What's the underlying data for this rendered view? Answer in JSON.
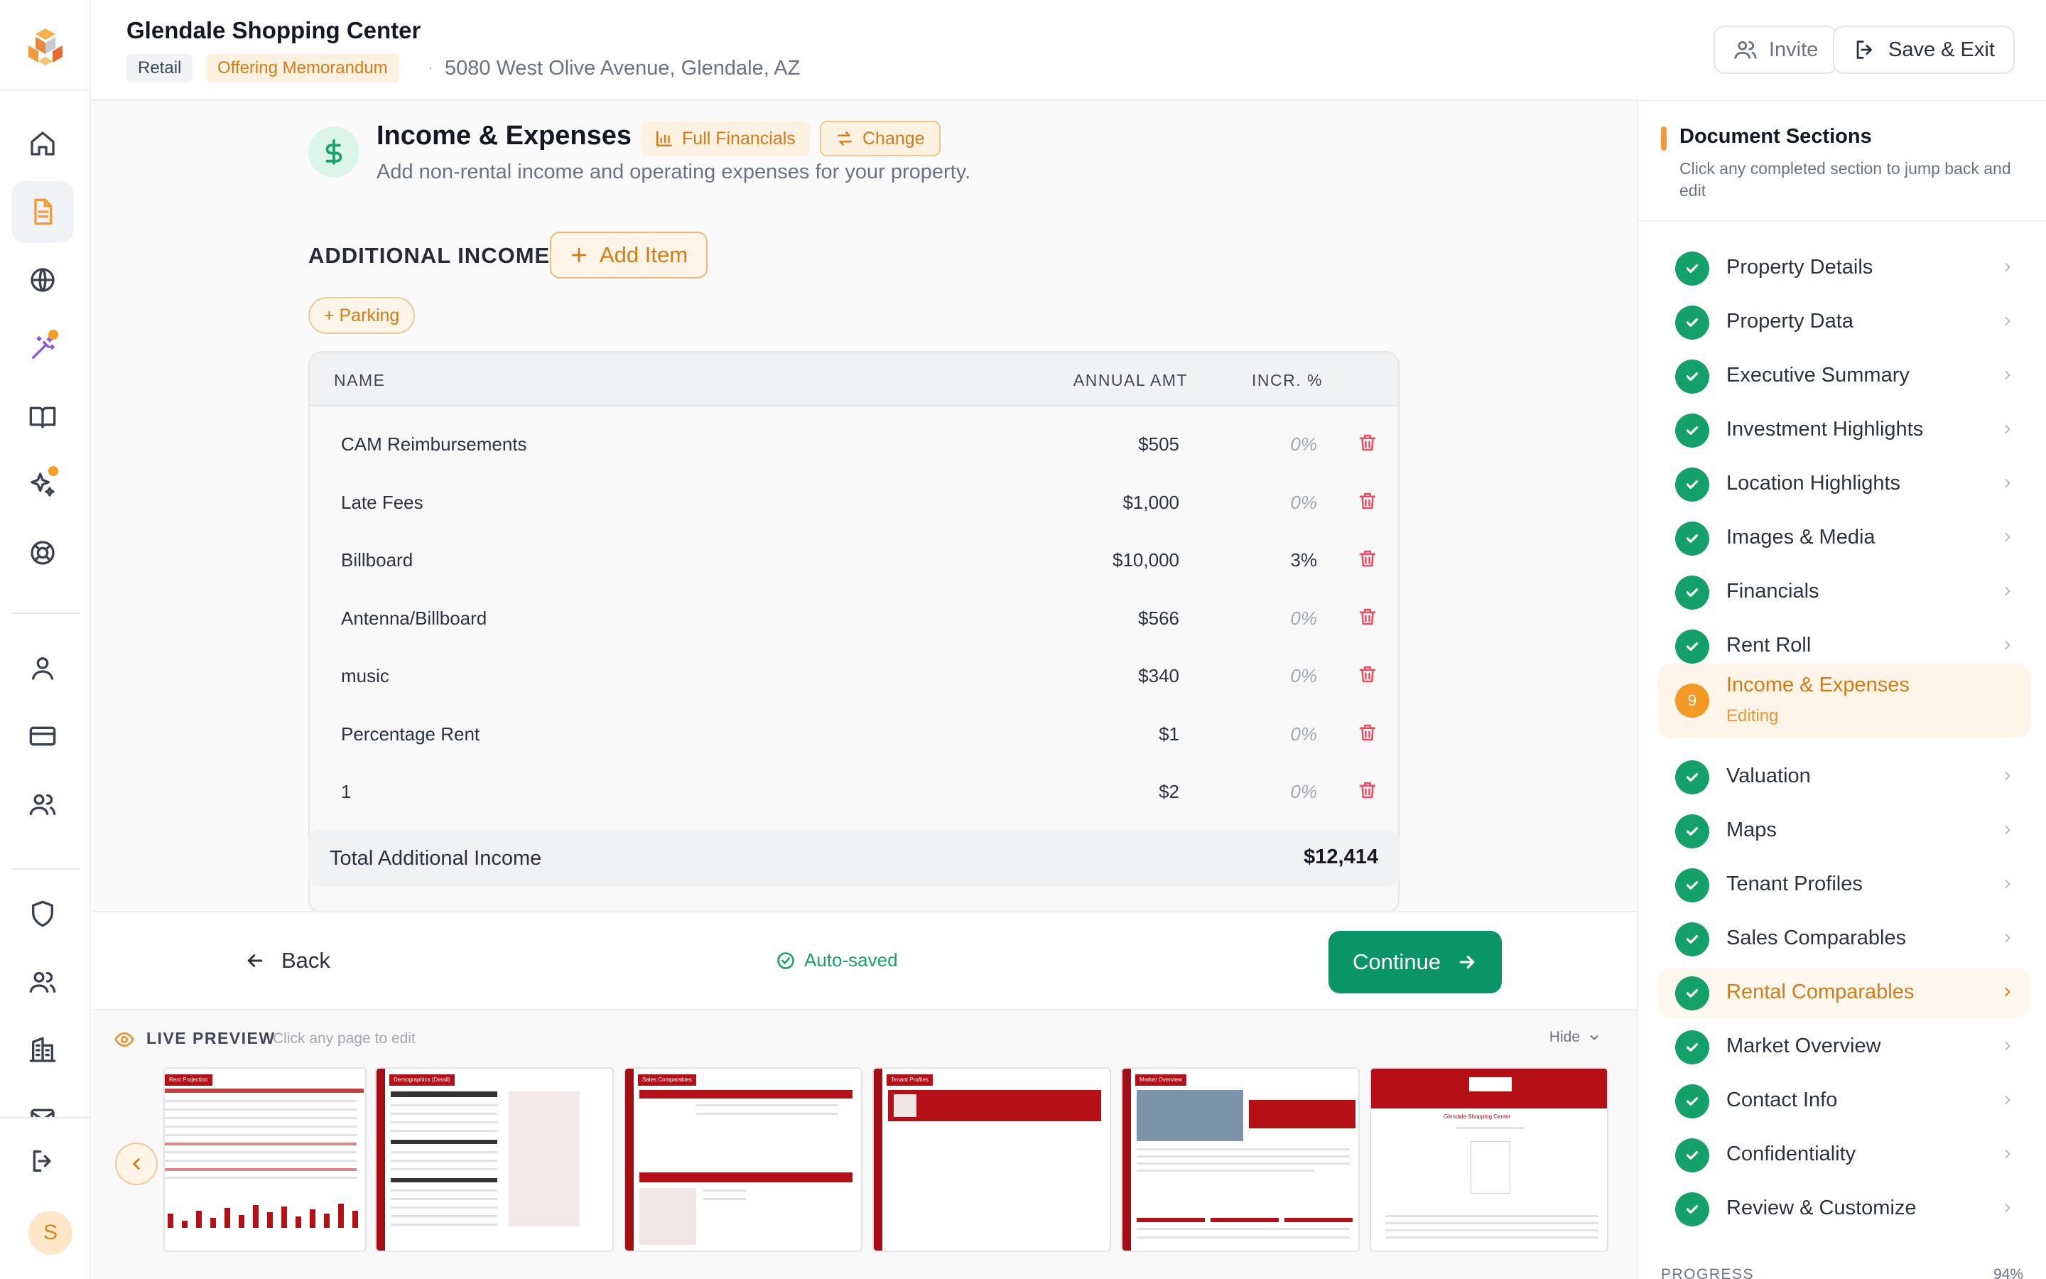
{
  "header": {
    "title": "Glendale Shopping Center",
    "tag_type": "Retail",
    "tag_doc": "Offering Memorandum",
    "separator": "·",
    "address": "5080 West Olive Avenue, Glendale, AZ",
    "invite_label": "Invite",
    "save_exit_label": "Save & Exit"
  },
  "rail": {
    "avatar_initial": "S",
    "accent_color": "#f29a3a"
  },
  "section": {
    "title": "Income & Expenses",
    "full_financials_label": "Full Financials",
    "change_label": "Change",
    "subtitle": "Add non-rental income and operating expenses for your property."
  },
  "additional_income": {
    "heading": "ADDITIONAL INCOME",
    "add_item_label": "Add Item",
    "quick_add": "+ Parking",
    "columns": {
      "name": "NAME",
      "amount": "ANNUAL AMT",
      "incr": "INCR. %"
    },
    "rows": [
      {
        "name": "CAM Reimbursements",
        "amount": "$505",
        "incr": "0%"
      },
      {
        "name": "Late Fees",
        "amount": "$1,000",
        "incr": "0%"
      },
      {
        "name": "Billboard",
        "amount": "$10,000",
        "incr": "3%"
      },
      {
        "name": "Antenna/Billboard",
        "amount": "$566",
        "incr": "0%"
      },
      {
        "name": "music",
        "amount": "$340",
        "incr": "0%"
      },
      {
        "name": "Percentage Rent",
        "amount": "$1",
        "incr": "0%"
      },
      {
        "name": "1",
        "amount": "$2",
        "incr": "0%"
      }
    ],
    "total_label": "Total Additional Income",
    "total_value": "$12,414"
  },
  "footer_nav": {
    "back_label": "Back",
    "autosaved_label": "Auto-saved",
    "continue_label": "Continue"
  },
  "preview": {
    "label": "LIVE PREVIEW",
    "hint": "Click any page to edit",
    "hide_label": "Hide",
    "pages": [
      "Rent Projection",
      "Demographics (Detail)",
      "Sales Comparables",
      "Tenant Profiles",
      "Market Overview",
      "Glendale Shopping Center"
    ]
  },
  "sidebar": {
    "title": "Document Sections",
    "subtitle": "Click any completed section to jump back and edit",
    "items": [
      {
        "label": "Property Details",
        "status": "done"
      },
      {
        "label": "Property Data",
        "status": "done"
      },
      {
        "label": "Executive Summary",
        "status": "done"
      },
      {
        "label": "Investment Highlights",
        "status": "done"
      },
      {
        "label": "Location Highlights",
        "status": "done"
      },
      {
        "label": "Images & Media",
        "status": "done"
      },
      {
        "label": "Financials",
        "status": "done"
      },
      {
        "label": "Rent Roll",
        "status": "done"
      },
      {
        "label": "Income & Expenses",
        "status": "current",
        "number": "9",
        "state": "Editing"
      },
      {
        "label": "Valuation",
        "status": "done"
      },
      {
        "label": "Maps",
        "status": "done"
      },
      {
        "label": "Tenant Profiles",
        "status": "done"
      },
      {
        "label": "Sales Comparables",
        "status": "done"
      },
      {
        "label": "Rental Comparables",
        "status": "done"
      },
      {
        "label": "Market Overview",
        "status": "done"
      },
      {
        "label": "Contact Info",
        "status": "done"
      },
      {
        "label": "Confidentiality",
        "status": "done"
      },
      {
        "label": "Review & Customize",
        "status": "done"
      }
    ],
    "progress_label": "PROGRESS",
    "progress_value": "94%"
  },
  "colors": {
    "brand_orange": "#d77a16",
    "success_green": "#0a9566",
    "delete_red": "#ef4b5c",
    "preview_red": "#b51017"
  }
}
